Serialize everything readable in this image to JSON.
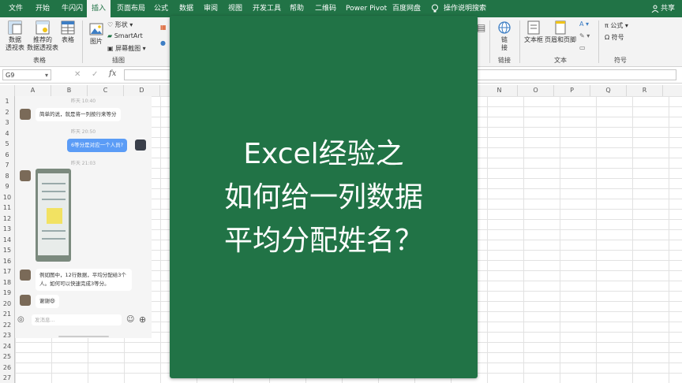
{
  "tabs": [
    "文件",
    "开始",
    "牛闪闪",
    "插入",
    "页面布局",
    "公式",
    "数据",
    "审阅",
    "视图",
    "开发工具",
    "帮助",
    "二维码",
    "Power Pivot",
    "百度网盘",
    "操作说明搜索"
  ],
  "active_tab": "插入",
  "share": "共享",
  "ribbon": {
    "pivot": "数据\n透视表",
    "recommended_pivot": "推荐的\n数据透视表",
    "table": "表格",
    "group_table": "表格",
    "picture": "图片",
    "shapes": "形状",
    "smartart": "SmartArt",
    "screenshot": "屏幕截图",
    "group_illustrations": "插图",
    "link": "链\n接",
    "group_link": "链接",
    "textbox": "文本框",
    "header_footer": "页眉和页脚",
    "group_text": "文本",
    "equation": "公式",
    "symbol": "符号",
    "group_symbol": "符号"
  },
  "formula_bar": {
    "namebox": "G9",
    "fx": "fx",
    "value": ""
  },
  "columns": [
    "A",
    "B",
    "C",
    "D",
    "",
    "",
    "",
    "",
    "",
    "",
    "",
    "",
    "",
    "N",
    "O",
    "P",
    "Q",
    "R"
  ],
  "rows": [
    "1",
    "2",
    "3",
    "4",
    "5",
    "6",
    "7",
    "8",
    "9",
    "10",
    "11",
    "12",
    "13",
    "14",
    "15",
    "16",
    "17",
    "18",
    "19",
    "20",
    "21",
    "22",
    "23",
    "24",
    "25",
    "26",
    "27"
  ],
  "chat": {
    "ts1": "昨天 10:40",
    "msg1": "简单的说，就是将一列按行来等分",
    "ts2": "昨天 20:50",
    "msg2": "6等分是对应一个人员?",
    "ts3": "昨天 21:03",
    "msg3": "例如图中，12行数据，平均分配给3个人。如何可以快速完成3等分。",
    "msg4": "谢谢😄",
    "input_placeholder": "发消息..."
  },
  "card": {
    "line1": "Excel经验之",
    "line2": "如何给一列数据",
    "line3": "平均分配姓名？"
  },
  "colors": {
    "excel_green": "#217346",
    "bubble_blue": "#5b9cf6"
  }
}
